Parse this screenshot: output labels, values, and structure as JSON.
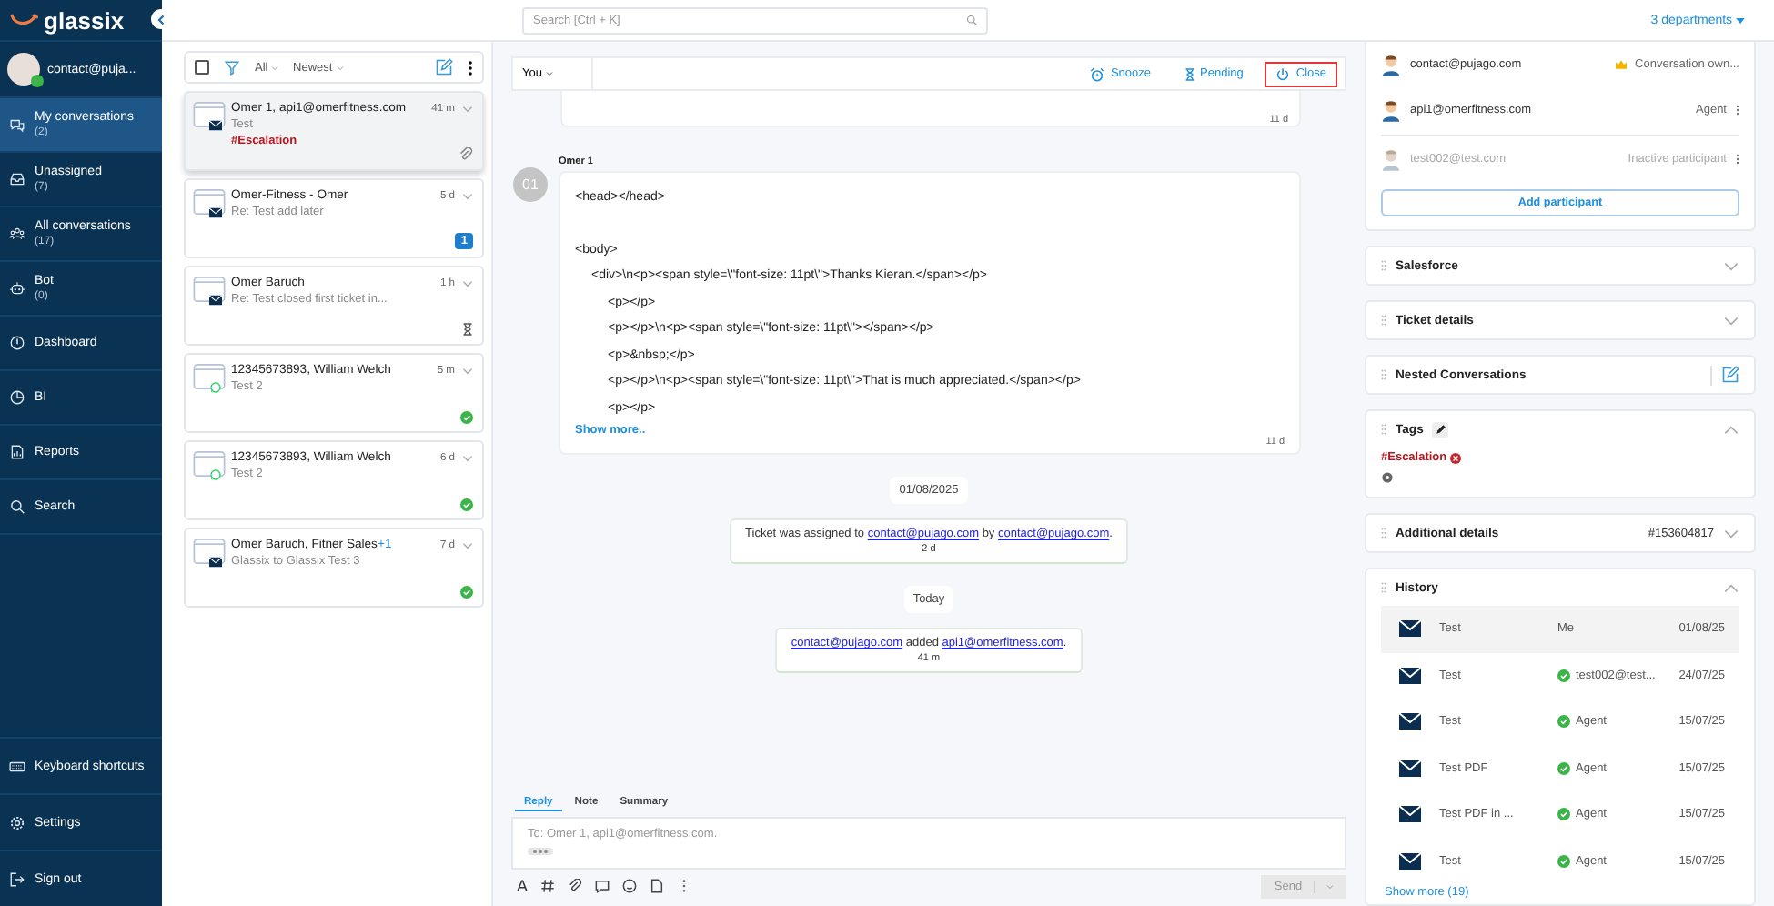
{
  "logo": "glassix",
  "user": {
    "email": "contact@puja...",
    "online": true
  },
  "nav": [
    {
      "label": "My conversations",
      "count": "(2)",
      "selected": true
    },
    {
      "label": "Unassigned",
      "count": "(7)",
      "selected": false
    },
    {
      "label": "All conversations",
      "count": "(17)",
      "selected": false
    },
    {
      "label": "Bot",
      "count": "(0)",
      "selected": false
    },
    {
      "label": "Dashboard",
      "selected": false
    },
    {
      "label": "BI",
      "selected": false
    },
    {
      "label": "Reports",
      "selected": false
    },
    {
      "label": "Search",
      "selected": false
    }
  ],
  "nav_bottom": [
    {
      "label": "Keyboard shortcuts"
    },
    {
      "label": "Settings"
    },
    {
      "label": "Sign out"
    }
  ],
  "search": {
    "placeholder": "Search [Ctrl + K]"
  },
  "departments": "3 departments",
  "list_toolbar": {
    "checked": false,
    "filter": "All",
    "sort": "Newest"
  },
  "conversations": [
    {
      "name": "Omer 1, api1@omerfitness.com",
      "time": "41 m",
      "preview": "Test",
      "kind": "email",
      "tag": "#Escalation",
      "indicator": {
        "kind": "attachment"
      },
      "selected": true
    },
    {
      "name": "Omer-Fitness - Omer",
      "time": "5 d",
      "preview": "Re: Test add later",
      "kind": "email",
      "indicator": {
        "kind": "badge",
        "text": "1"
      },
      "selected": false
    },
    {
      "name": "Omer Baruch",
      "time": "1 h",
      "preview": "Re: Test closed first ticket in...",
      "kind": "email",
      "indicator": {
        "kind": "pending"
      },
      "selected": false
    },
    {
      "name": "12345673893, William Welch",
      "time": "5 m",
      "preview": "Test 2",
      "kind": "whatsapp",
      "indicator": {
        "kind": "done"
      },
      "selected": false
    },
    {
      "name": "12345673893, William Welch",
      "time": "6 d",
      "preview": "Test 2",
      "kind": "whatsapp",
      "indicator": {
        "kind": "done"
      },
      "selected": false
    },
    {
      "name": "Omer Baruch, Fitner Sales",
      "extra": "+1",
      "time": "7 d",
      "preview": "Glassix to Glassix Test 3",
      "kind": "email",
      "indicator": {
        "kind": "done"
      },
      "selected": false
    }
  ],
  "toolbar": {
    "assignee": "You",
    "actions": [
      {
        "kind": "snooze",
        "label": "Snooze",
        "highlighted": false
      },
      {
        "kind": "pending",
        "label": "Pending",
        "highlighted": false
      },
      {
        "kind": "close",
        "label": "Close",
        "highlighted": true
      }
    ]
  },
  "previous_message": {
    "time": "11 d"
  },
  "message": {
    "avatar": "01",
    "sender": "Omer 1",
    "show_more": "Show more..",
    "time": "11 d",
    "body": [
      {
        "text": "<head></head>"
      },
      {
        "text": "<body>",
        "children": [
          {
            "text": "<div>\\n<p><span style=\\\"font-size: 11pt\\\">Thanks Kieran.</span></p>",
            "children": [
              {
                "text": "<p></p>"
              },
              {
                "text": "<p></p>\\n<p><span style=\\\"font-size: 11pt\\\"></span></p>"
              },
              {
                "text": "<p>&nbsp;</p>"
              },
              {
                "text": "<p></p>\\n<p><span style=\\\"font-size: 11pt\\\">That is much appreciated.</span></p>"
              },
              {
                "text": "<p></p>"
              }
            ]
          }
        ]
      }
    ]
  },
  "events": [
    {
      "kind": "date",
      "text": "01/08/2025"
    },
    {
      "kind": "system",
      "parts": [
        {
          "text": "Ticket was assigned to "
        },
        {
          "text": "contact@pujago.com",
          "link": true
        },
        {
          "text": " by "
        },
        {
          "text": "contact@pujago.com",
          "link": true
        },
        {
          "text": "."
        }
      ],
      "time": "2 d"
    },
    {
      "kind": "date",
      "text": "Today"
    },
    {
      "kind": "system",
      "parts": [
        {
          "text": "contact@pujago.com",
          "link": true
        },
        {
          "text": " added "
        },
        {
          "text": "api1@omerfitness.com",
          "link": true
        },
        {
          "text": "."
        }
      ],
      "time": "41 m"
    }
  ],
  "composer": {
    "tabs": [
      {
        "label": "Reply",
        "selected": true
      },
      {
        "label": "Note",
        "selected": false
      },
      {
        "label": "Summary",
        "selected": false
      }
    ],
    "format_icon": "A",
    "placeholder": "To: Omer 1, api1@omerfitness.com.",
    "send": {
      "label": "Send",
      "disabled": true
    }
  },
  "participants": [
    {
      "email": "contact@pujago.com",
      "role": "Conversation own...",
      "owner": true,
      "active": true
    },
    {
      "email": "api1@omerfitness.com",
      "role": "Agent",
      "owner": false,
      "active": true
    },
    {
      "email": "test002@test.com",
      "role": "Inactive participant",
      "owner": false,
      "active": false
    }
  ],
  "add_participant": "Add participant",
  "sections": [
    {
      "kind": "collapsible",
      "title": "Salesforce",
      "expanded": false
    },
    {
      "kind": "collapsible",
      "title": "Ticket details",
      "expanded": false
    },
    {
      "kind": "nested",
      "title": "Nested Conversations"
    },
    {
      "kind": "tags",
      "title": "Tags",
      "expanded": true,
      "tags": [
        "#Escalation"
      ]
    },
    {
      "kind": "details",
      "title": "Additional details",
      "value": "#153604817",
      "expanded": false
    },
    {
      "kind": "history",
      "title": "History",
      "expanded": true,
      "show_more": "Show more (19)",
      "rows": [
        {
          "subject": "Test",
          "agent": "Me",
          "done": false,
          "date": "01/08/25",
          "selected": true
        },
        {
          "subject": "Test",
          "agent": "test002@test...",
          "done": true,
          "date": "24/07/25",
          "selected": false
        },
        {
          "subject": "Test",
          "agent": "Agent",
          "done": true,
          "date": "15/07/25",
          "selected": false
        },
        {
          "subject": "Test PDF",
          "agent": "Agent",
          "done": true,
          "date": "15/07/25",
          "selected": false
        },
        {
          "subject": "Test PDF in ...",
          "agent": "Agent",
          "done": true,
          "date": "15/07/25",
          "selected": false
        },
        {
          "subject": "Test",
          "agent": "Agent",
          "done": true,
          "date": "15/07/25",
          "selected": false
        }
      ]
    }
  ]
}
